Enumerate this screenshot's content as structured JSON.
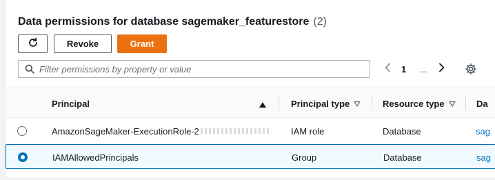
{
  "header": {
    "title": "Data permissions for database sagemaker_featurestore",
    "count": "(2)"
  },
  "toolbar": {
    "refresh_icon": "refresh-icon",
    "revoke_label": "Revoke",
    "grant_label": "Grant",
    "grant_color": "#ec7211"
  },
  "search": {
    "placeholder": "Filter permissions by property or value",
    "icon": "search-icon"
  },
  "pagination": {
    "prev_icon": "chevron-left-icon",
    "current_page": "1",
    "ellipsis": "...",
    "next_icon": "chevron-right-icon"
  },
  "settings_icon": "gear-icon",
  "table": {
    "columns": [
      {
        "label": "Principal",
        "sort": "ascending"
      },
      {
        "label": "Principal type",
        "sort": "sortable"
      },
      {
        "label": "Resource type",
        "sort": "sortable"
      },
      {
        "label": "Da"
      }
    ],
    "rows": [
      {
        "selected": false,
        "principal": "AmazonSageMaker-ExecutionRole-2",
        "principal_type": "IAM role",
        "resource_type": "Database",
        "data": "sag"
      },
      {
        "selected": true,
        "principal": "IAMAllowedPrincipals",
        "principal_type": "Group",
        "resource_type": "Database",
        "data": "sag"
      }
    ]
  },
  "colors": {
    "accent": "#0073bb",
    "selected_row_bg": "#f1faff"
  }
}
